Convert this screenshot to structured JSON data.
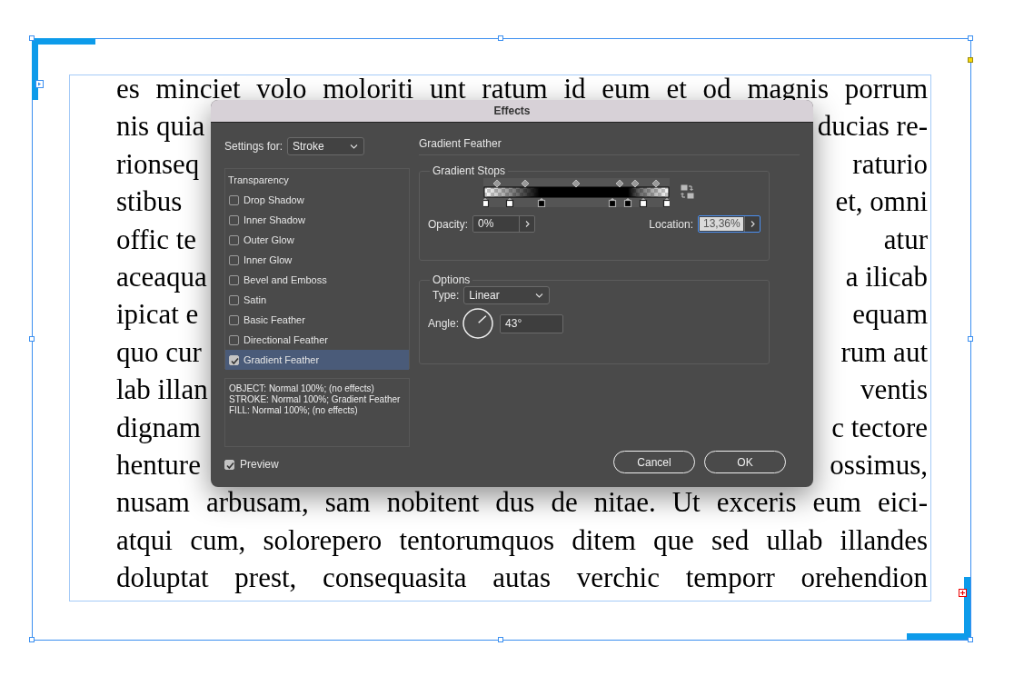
{
  "document": {
    "text_lines": [
      {
        "kind": "full",
        "text": "es minciet volo moloriti unt ratum id eum et od magnis porrum"
      },
      {
        "kind": "split",
        "left": "nis quia",
        "right": "ducias re-"
      },
      {
        "kind": "split",
        "left": "rionseq",
        "right": "raturio"
      },
      {
        "kind": "split",
        "left": "stibus",
        "right": "et, omni"
      },
      {
        "kind": "split",
        "left": "offic te",
        "right": "atur"
      },
      {
        "kind": "split",
        "left": "aceaqua",
        "right": "a ilicab"
      },
      {
        "kind": "split",
        "left": "ipicat e",
        "right": "equam"
      },
      {
        "kind": "split",
        "left": "quo cur",
        "right": "rum aut"
      },
      {
        "kind": "split",
        "left": "lab illan",
        "right": "ventis"
      },
      {
        "kind": "split",
        "left": "dignam",
        "right": "c tectore"
      },
      {
        "kind": "split",
        "left": "henture",
        "right": "ossimus,"
      },
      {
        "kind": "full",
        "text": "nusam arbusam, sam nobitent dus de nitae. Ut exceris eum eici-"
      },
      {
        "kind": "full",
        "text": "atqui cum, solorepero tentorumquos ditem que sed ullab illandes"
      },
      {
        "kind": "full",
        "text": "doluptat prest, consequasita autas verchic temporr orehendion"
      }
    ]
  },
  "dialog": {
    "title": "Effects",
    "settings_for": {
      "label": "Settings for:",
      "value": "Stroke"
    },
    "effects_list": {
      "heading": "Transparency",
      "items": [
        {
          "label": "Drop Shadow",
          "checked": false,
          "selected": false
        },
        {
          "label": "Inner Shadow",
          "checked": false,
          "selected": false
        },
        {
          "label": "Outer Glow",
          "checked": false,
          "selected": false
        },
        {
          "label": "Inner Glow",
          "checked": false,
          "selected": false
        },
        {
          "label": "Bevel and Emboss",
          "checked": false,
          "selected": false
        },
        {
          "label": "Satin",
          "checked": false,
          "selected": false
        },
        {
          "label": "Basic Feather",
          "checked": false,
          "selected": false
        },
        {
          "label": "Directional Feather",
          "checked": false,
          "selected": false
        },
        {
          "label": "Gradient Feather",
          "checked": true,
          "selected": true
        }
      ]
    },
    "summary": [
      "OBJECT: Normal 100%; (no effects)",
      "STROKE: Normal 100%; Gradient Feather",
      "FILL: Normal 100%; (no effects)"
    ],
    "preview": {
      "label": "Preview",
      "checked": true
    },
    "panel_title": "Gradient Feather",
    "gradient_stops": {
      "legend": "Gradient Stops",
      "opacity": {
        "label": "Opacity:",
        "value": "0%"
      },
      "location": {
        "label": "Location:",
        "value": "13,36%"
      }
    },
    "options": {
      "legend": "Options",
      "type": {
        "label": "Type:",
        "value": "Linear"
      },
      "angle": {
        "label": "Angle:",
        "value": "43°"
      }
    },
    "buttons": [
      {
        "label": "Cancel"
      },
      {
        "label": "OK"
      }
    ]
  }
}
